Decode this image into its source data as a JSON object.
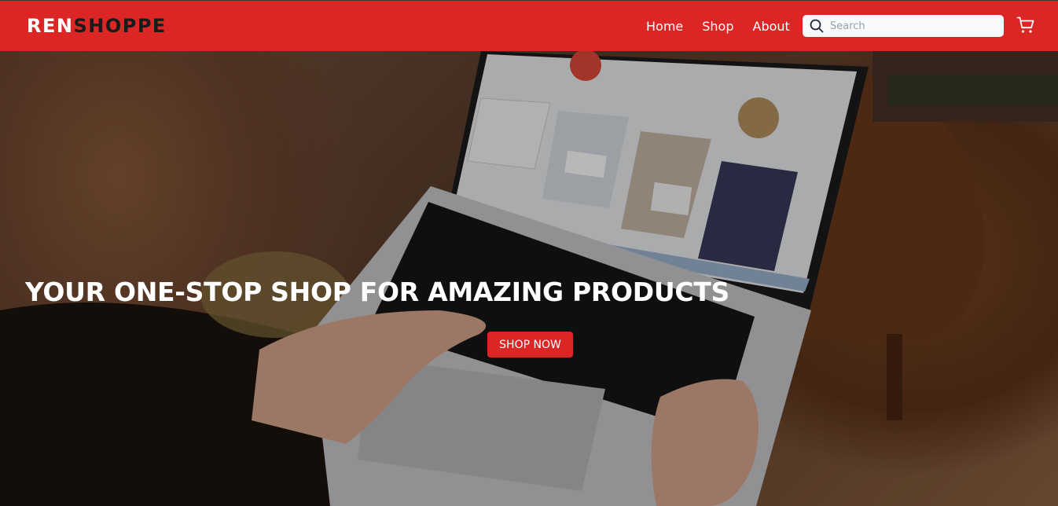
{
  "brand": {
    "part1": "REN",
    "part2": "SHOPPE"
  },
  "nav": {
    "links": [
      "Home",
      "Shop",
      "About"
    ]
  },
  "search": {
    "placeholder": "Search",
    "value": ""
  },
  "hero": {
    "title": "YOUR ONE-STOP SHOP FOR AMAZING PRODUCTS",
    "cta": "SHOP NOW",
    "image_subject": "person using laptop showing online shop"
  },
  "icons": {
    "search": "search-icon",
    "cart": "cart-icon"
  },
  "colors": {
    "primary": "#dc2626",
    "nav_text": "#ffffff",
    "logo_dark": "#1a1a1a"
  }
}
